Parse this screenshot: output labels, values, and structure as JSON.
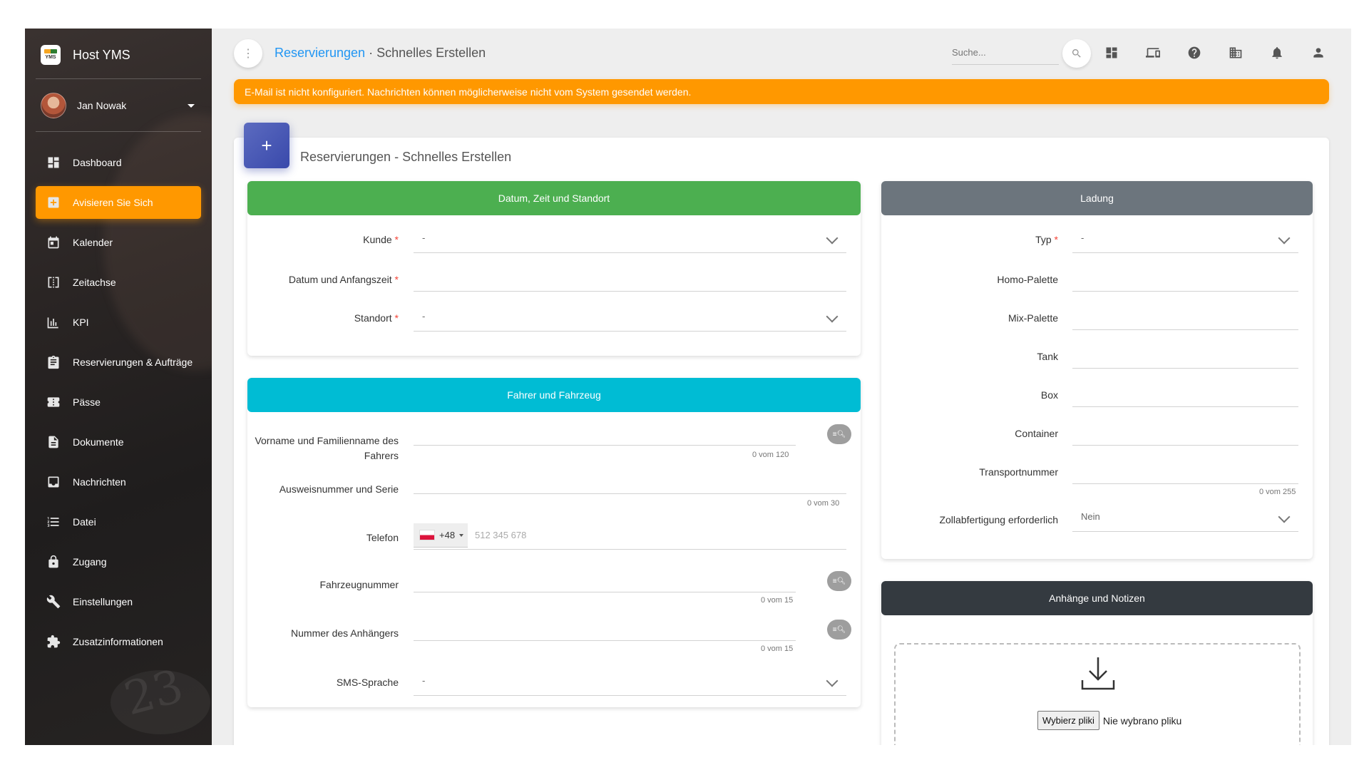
{
  "app": {
    "name": "Host YMS",
    "logo_text": "YMS"
  },
  "user": {
    "name": "Jan Nowak"
  },
  "sidebar": {
    "items": [
      {
        "label": "Dashboard",
        "icon": "dashboard-icon"
      },
      {
        "label": "Avisieren Sie Sich",
        "icon": "add-box-icon",
        "active": true
      },
      {
        "label": "Kalender",
        "icon": "calendar-icon"
      },
      {
        "label": "Zeitachse",
        "icon": "timeline-icon"
      },
      {
        "label": "KPI",
        "icon": "chart-icon"
      },
      {
        "label": "Reservierungen & Aufträge",
        "icon": "clipboard-icon"
      },
      {
        "label": "Pässe",
        "icon": "ticket-icon"
      },
      {
        "label": "Dokumente",
        "icon": "document-icon"
      },
      {
        "label": "Nachrichten",
        "icon": "inbox-icon"
      },
      {
        "label": "Datei",
        "icon": "list-icon"
      },
      {
        "label": "Zugang",
        "icon": "lock-icon"
      },
      {
        "label": "Einstellungen",
        "icon": "wrench-icon"
      },
      {
        "label": "Zusatzinformationen",
        "icon": "puzzle-icon"
      }
    ],
    "decor_text": "23"
  },
  "topbar": {
    "breadcrumb_link": "Reservierungen",
    "breadcrumb_sep": " · ",
    "breadcrumb_current": "Schnelles Erstellen",
    "search_placeholder": "Suche...",
    "icons": [
      "dashboard-icon",
      "devices-icon",
      "help-icon",
      "building-icon",
      "bell-icon",
      "person-icon"
    ]
  },
  "alert": {
    "text": "E-Mail ist nicht konfiguriert. Nachrichten können möglicherweise nicht vom System gesendet werden."
  },
  "card": {
    "title": "Reservierungen - Schnelles Erstellen",
    "plus": "+"
  },
  "section_date": {
    "title": "Datum, Zeit und Standort",
    "color": "#4caf50",
    "kunde_label": "Kunde",
    "kunde_value": "-",
    "datum_label": "Datum und Anfangszeit",
    "datum_value": "",
    "standort_label": "Standort",
    "standort_value": "-",
    "required_mark": "*"
  },
  "section_driver": {
    "title": "Fahrer und Fahrzeug",
    "color": "#00bcd4",
    "name_label": "Vorname und Familienname des Fahrers",
    "name_counter": "0 vom 120",
    "id_label": "Ausweisnummer und Serie",
    "id_counter": "0 vom 30",
    "phone_label": "Telefon",
    "phone_prefix": "+48",
    "phone_placeholder": "512 345 678",
    "vehicle_label": "Fahrzeugnummer",
    "vehicle_counter": "0 vom 15",
    "trailer_label": "Nummer des Anhängers",
    "trailer_counter": "0 vom 15",
    "sms_label": "SMS-Sprache",
    "sms_value": "-",
    "lookup_icon": "search-list-icon"
  },
  "section_cargo": {
    "title": "Ladung",
    "color": "#6c757d",
    "typ_label": "Typ",
    "typ_value": "-",
    "homo_label": "Homo-Palette",
    "mix_label": "Mix-Palette",
    "tank_label": "Tank",
    "box_label": "Box",
    "container_label": "Container",
    "transport_label": "Transportnummer",
    "transport_counter": "0 vom 255",
    "zoll_label": "Zollabfertigung erforderlich",
    "zoll_value": "Nein"
  },
  "section_attach": {
    "title": "Anhänge und Notizen",
    "color": "#343a40",
    "file_button": "Wybierz pliki",
    "file_status": "Nie wybrano pliku",
    "icon": "download-icon"
  }
}
